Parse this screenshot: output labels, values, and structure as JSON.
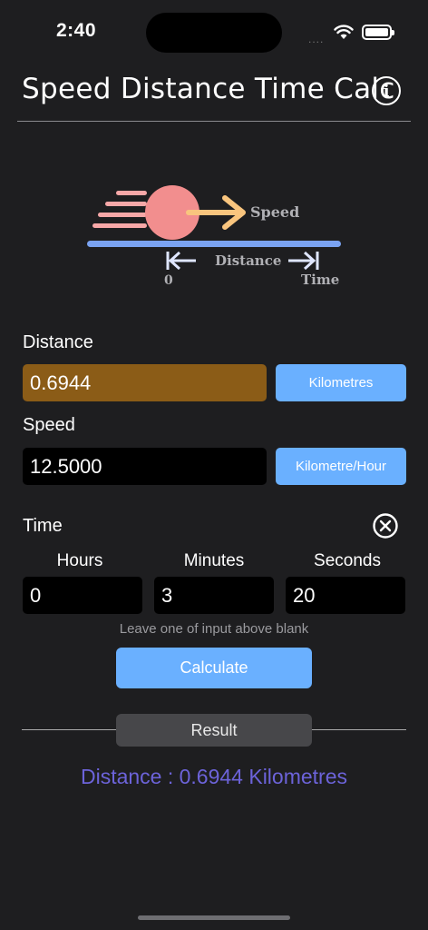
{
  "status": {
    "time": "2:40",
    "signal": "....",
    "wifi_icon": "wifi-icon",
    "battery_icon": "battery-icon"
  },
  "header": {
    "title": "Speed Distance Time Calc",
    "info_icon": "info-icon",
    "info_glyph": "i"
  },
  "illustration": {
    "speed_label": "Speed",
    "distance_label": "Distance",
    "zero_label": "0",
    "time_label": "Time"
  },
  "distance": {
    "label": "Distance",
    "value": "0.6944",
    "unit": "Kilometres"
  },
  "speed": {
    "label": "Speed",
    "value": "12.5000",
    "unit": "Kilometre/Hour"
  },
  "time": {
    "label": "Time",
    "clear_icon": "clear-circle-icon",
    "hours_label": "Hours",
    "hours_value": "0",
    "minutes_label": "Minutes",
    "minutes_value": "3",
    "seconds_label": "Seconds",
    "seconds_value": "20"
  },
  "hint": "Leave one of input above blank",
  "calculate_label": "Calculate",
  "result": {
    "label": "Result",
    "text": "Distance : 0.6944 Kilometres"
  },
  "colors": {
    "background": "#1e1e20",
    "accent_button": "#6ab0ff",
    "distance_field": "#8b5c17",
    "result_text": "#6c63d9"
  }
}
